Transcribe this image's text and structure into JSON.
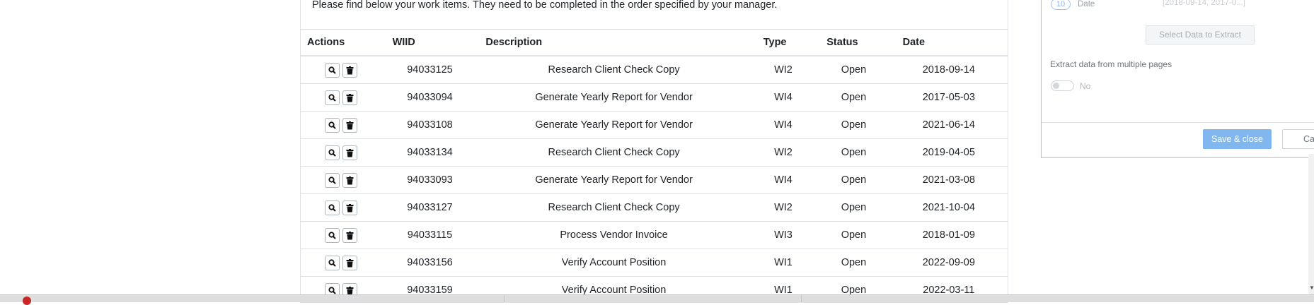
{
  "intro_text": "Please find below your work items. They need to be completed in the order specified by your manager.",
  "table": {
    "headers": {
      "actions": "Actions",
      "wiid": "WIID",
      "description": "Description",
      "type": "Type",
      "status": "Status",
      "date": "Date"
    },
    "action_icons": [
      "search-icon",
      "trash-icon"
    ],
    "rows": [
      {
        "wiid": "94033125",
        "description": "Research Client Check Copy",
        "type": "WI2",
        "status": "Open",
        "date": "2018-09-14"
      },
      {
        "wiid": "94033094",
        "description": "Generate Yearly Report for Vendor",
        "type": "WI4",
        "status": "Open",
        "date": "2017-05-03"
      },
      {
        "wiid": "94033108",
        "description": "Generate Yearly Report for Vendor",
        "type": "WI4",
        "status": "Open",
        "date": "2021-06-14"
      },
      {
        "wiid": "94033134",
        "description": "Research Client Check Copy",
        "type": "WI2",
        "status": "Open",
        "date": "2019-04-05"
      },
      {
        "wiid": "94033093",
        "description": "Generate Yearly Report for Vendor",
        "type": "WI4",
        "status": "Open",
        "date": "2021-03-08"
      },
      {
        "wiid": "94033127",
        "description": "Research Client Check Copy",
        "type": "WI2",
        "status": "Open",
        "date": "2021-10-04"
      },
      {
        "wiid": "94033115",
        "description": "Process Vendor Invoice",
        "type": "WI3",
        "status": "Open",
        "date": "2018-01-09"
      },
      {
        "wiid": "94033156",
        "description": "Verify Account Position",
        "type": "WI1",
        "status": "Open",
        "date": "2022-09-09"
      },
      {
        "wiid": "94033159",
        "description": "Verify Account Position",
        "type": "WI1",
        "status": "Open",
        "date": "2022-03-11"
      }
    ]
  },
  "dialog": {
    "date_field": {
      "index": "10",
      "label": "Date",
      "preview": "[2018-09-14, 2017-0...]"
    },
    "select_button": "Select Data to Extract",
    "multi_page_label": "Extract data from multiple pages",
    "toggle_value": "No",
    "save_button": "Save & close",
    "cancel_button": "Ca"
  },
  "colors": {
    "save_button_bg": "#7fb7ee",
    "dialog_border": "#9ec5fe",
    "status_dot": "#c62828"
  }
}
